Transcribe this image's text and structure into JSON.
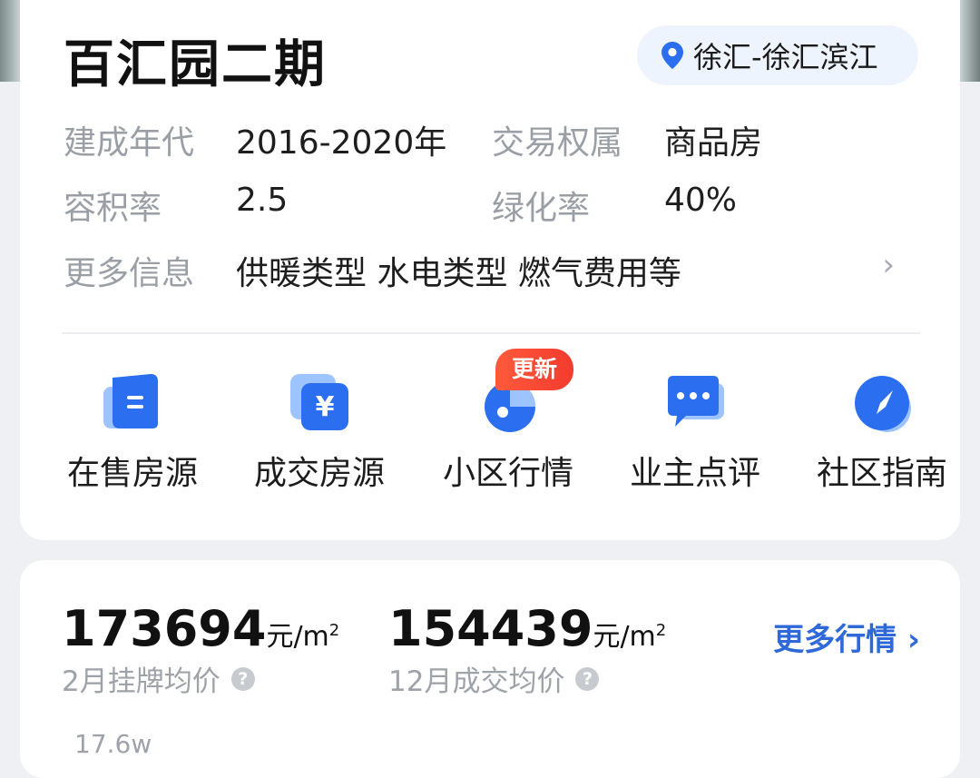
{
  "header": {
    "title": "百汇园二期",
    "location": "徐汇-徐汇滨江",
    "location_icon": "map-pin-icon"
  },
  "info": [
    {
      "label": "建成年代",
      "value": "2016-2020年"
    },
    {
      "label": "交易权属",
      "value": "商品房"
    },
    {
      "label": "容积率",
      "value": "2.5"
    },
    {
      "label": "绿化率",
      "value": "40%"
    },
    {
      "label": "更多信息",
      "value": "供暖类型 水电类型 燃气费用等"
    }
  ],
  "features": [
    {
      "label": "在售房源",
      "icon": "listing-icon"
    },
    {
      "label": "成交房源",
      "icon": "yuan-icon"
    },
    {
      "label": "小区行情",
      "icon": "chart-icon",
      "badge": "更新"
    },
    {
      "label": "业主点评",
      "icon": "chat-icon"
    },
    {
      "label": "社区指南",
      "icon": "compass-icon"
    }
  ],
  "prices": {
    "listing": {
      "value": "173694",
      "unit": "元/m",
      "sup": "2",
      "label": "2月挂牌均价"
    },
    "deal": {
      "value": "154439",
      "unit": "元/m",
      "sup": "2",
      "label": "12月成交均价"
    },
    "more": "更多行情",
    "chart_top_label": "17.6w"
  },
  "colors": {
    "accent": "#2f69d9",
    "badge": "#f33b2d",
    "icon_blue": "#2b6ff0"
  }
}
